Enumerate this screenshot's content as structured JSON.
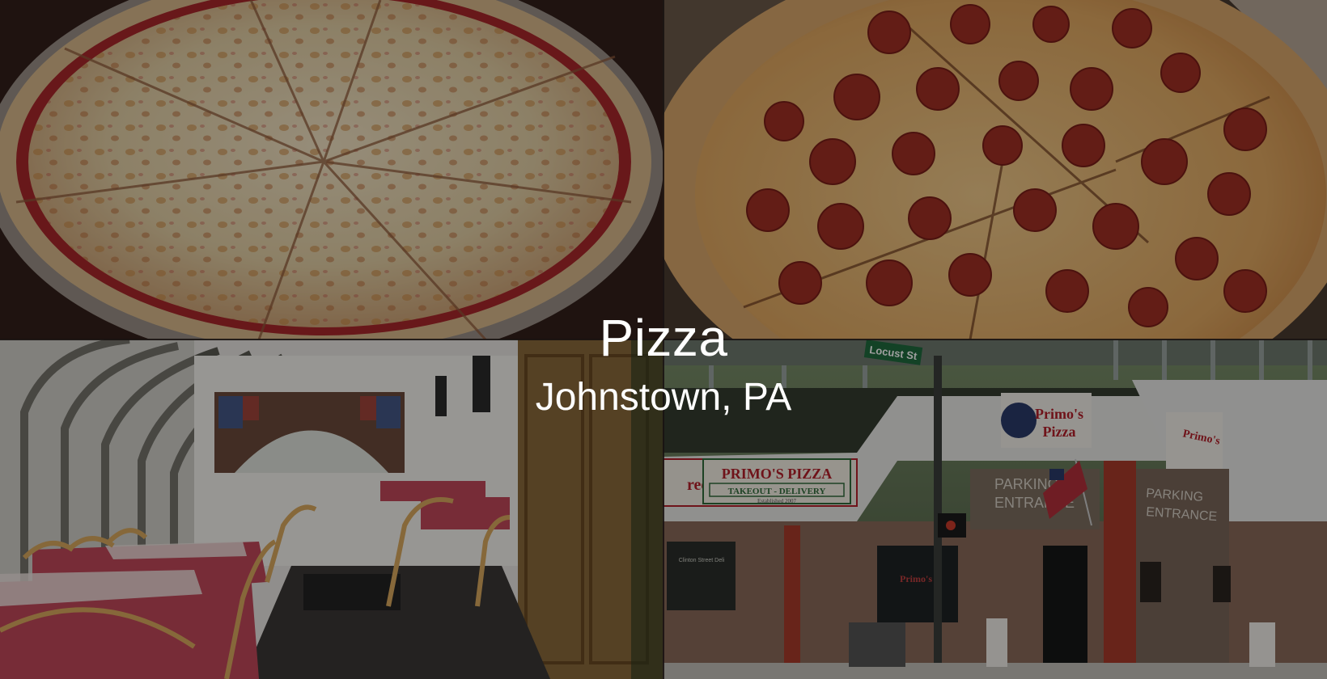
{
  "caption": {
    "title": "Pizza",
    "subtitle": "Johnstown, PA"
  },
  "tiles": [
    {
      "name": "cheese-pizza-photo",
      "subject": "cheese pizza"
    },
    {
      "name": "pepperoni-pizza-photo",
      "subject": "pepperoni pizza"
    },
    {
      "name": "dining-room-photo",
      "subject": "restaurant interior"
    },
    {
      "name": "storefront-photo",
      "subject": "Primo's Pizza storefront"
    }
  ],
  "storefront": {
    "street_sign": "Locust St",
    "main_sign": "PRIMO'S PIZZA",
    "main_sign_sub": "TAKEOUT - DELIVERY",
    "main_sign_est": "Established 2007",
    "logo_sign": "Primo's Pizza",
    "parking_left": "PARKING\nENTRANCE",
    "parking_right": "PARKING\nENTRANCE",
    "left_partial_sign": "reet",
    "neighbor_sign": "Clinton Street Deli",
    "window_sign": "Primo's"
  },
  "colors": {
    "sauce": "#a8282a",
    "cheese": "#e6d4b0",
    "crust": "#d9b98a",
    "pepperoni": "#8a1f1a",
    "tablecloth": "#c0485a",
    "sign_red": "#b4202a",
    "sign_green": "#2f6b3a",
    "street_sign_green": "#1f6b3e"
  }
}
